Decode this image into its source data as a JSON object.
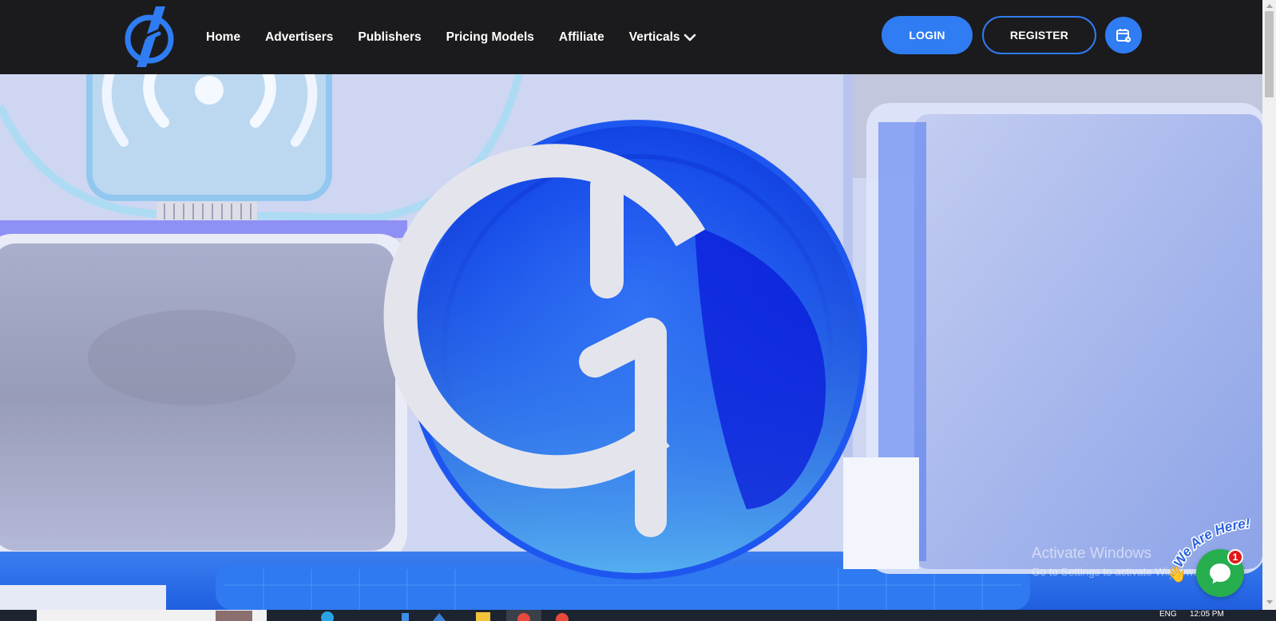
{
  "nav": {
    "links": [
      {
        "label": "Home"
      },
      {
        "label": "Advertisers"
      },
      {
        "label": "Publishers"
      },
      {
        "label": "Pricing Models"
      },
      {
        "label": "Affiliate"
      },
      {
        "label": "Verticals"
      }
    ],
    "login_label": "LOGIN",
    "register_label": "REGISTER",
    "icons": {
      "logo": "brand-logo",
      "calendar": "calendar-icon",
      "dropdown": "chevron-down-icon"
    }
  },
  "watermark": {
    "line1": "Activate Windows",
    "line2": "Go to Settings to activate Windows."
  },
  "chat": {
    "badge_count": "1",
    "tagline": "We Are Here!"
  },
  "taskbar": {
    "lang": "ENG",
    "time": "12:05 PM"
  },
  "colors": {
    "accent": "#2f7cf3",
    "nav_bg": "#1b1b1d",
    "chat_green": "#27ae4f"
  }
}
